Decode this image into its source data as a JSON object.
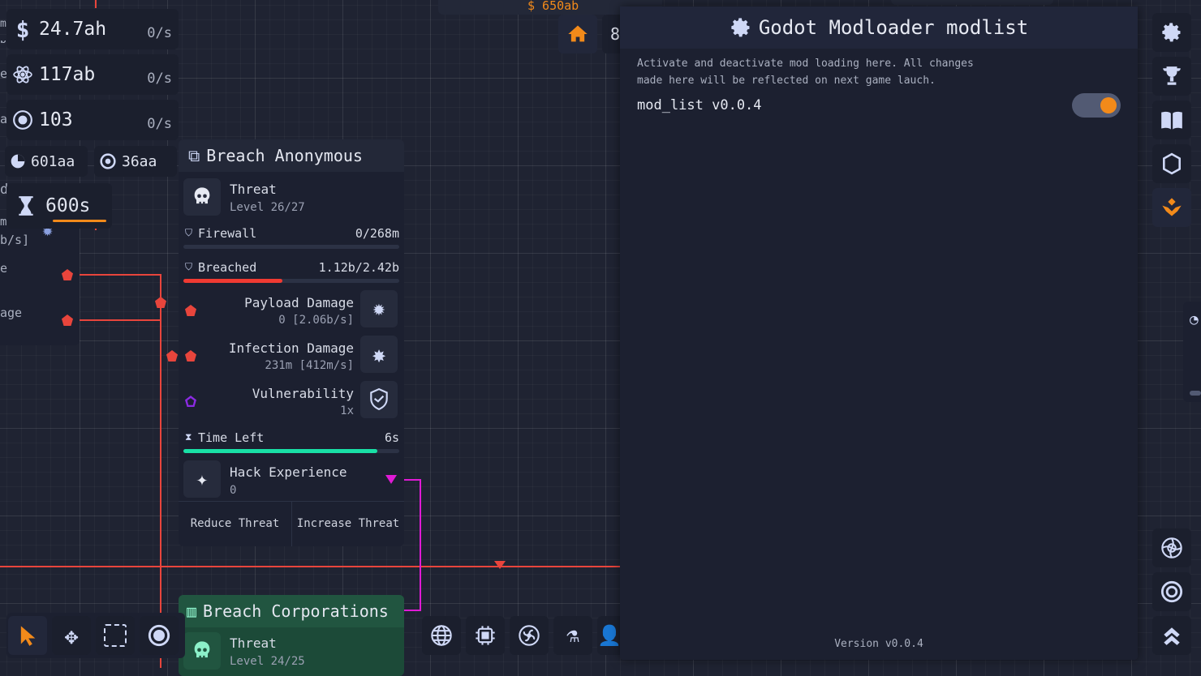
{
  "top_strip": {
    "money_partial": "$ 650ab"
  },
  "resources": [
    {
      "icon": "dollar-icon",
      "value": "24.7ah",
      "rate": "0/s"
    },
    {
      "icon": "atom-icon",
      "value": "117ab",
      "rate": "0/s"
    },
    {
      "icon": "target-icon",
      "value": "103",
      "rate": "0/s"
    }
  ],
  "small_resources": [
    {
      "icon": "pie-icon",
      "value": "601aa"
    },
    {
      "icon": "spiral-icon",
      "value": "36aa"
    }
  ],
  "timer": {
    "value": "600s"
  },
  "left_partial": {
    "fragment_m1": "m",
    "fragment_rate1": "b/s]",
    "fragment_e1": "e",
    "fragment_a": "a",
    "fragment_d": "d",
    "fragment_m2": "m",
    "fragment_rate2": "b/s]",
    "fragment_e2": "e",
    "fragment_age": "age"
  },
  "node": {
    "title": "Breach Anonymous",
    "threat": {
      "label": "Threat",
      "level": "Level 26/27"
    },
    "firewall": {
      "label": "Firewall",
      "value": "0/268m",
      "progress": 0
    },
    "breached": {
      "label": "Breached",
      "value": "1.12b/2.42b",
      "progress": 0.46
    },
    "payload": {
      "label": "Payload Damage",
      "value": "0 [2.06b/s]"
    },
    "infection": {
      "label": "Infection Damage",
      "value": "231m [412m/s]"
    },
    "vulnerability": {
      "label": "Vulnerability",
      "value": "1x"
    },
    "time_left": {
      "label": "Time Left",
      "value": "6s",
      "progress": 0.9
    },
    "hack_exp": {
      "label": "Hack Experience",
      "value": "0"
    },
    "buttons": {
      "reduce": "Reduce Threat",
      "increase": "Increase Threat"
    }
  },
  "node2": {
    "title": "Breach Corporations",
    "threat": {
      "label": "Threat",
      "level": "Level 24/25"
    }
  },
  "modal": {
    "title": "Godot Modloader modlist",
    "description_line1": "Activate and deactivate mod loading here. All changes",
    "description_line2": "made here will be reflected on next game lauch.",
    "mod_name": "mod_list v0.0.4",
    "mod_enabled": true,
    "version": "Version v0.0.4"
  },
  "colors": {
    "accent_orange": "#f28a1a",
    "wire_red": "#e8453c",
    "wire_magenta": "#e01ad6",
    "time_green": "#19e0a6",
    "node2_green": "#1c4a38"
  }
}
